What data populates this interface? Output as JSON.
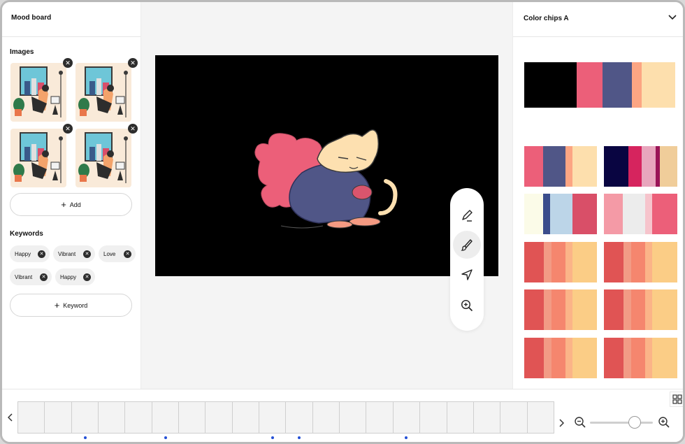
{
  "left_panel": {
    "title": "Mood board",
    "images_label": "Images",
    "add_label": "Add",
    "keywords_label": "Keywords",
    "keywords": [
      "Happy",
      "Vibrant",
      "Love",
      "Vibrant",
      "Happy"
    ],
    "add_keyword_label": "Keyword",
    "close_icon": "close-icon"
  },
  "right_panel": {
    "title": "Color chips A",
    "dropdown_icon": "chevron-down-icon"
  },
  "tools": [
    "pen-icon",
    "brush-icon",
    "navigate-icon",
    "zoom-in-icon"
  ],
  "colors": {
    "pink": "#ec5f79",
    "navy": "#505687",
    "peach": "#fca583",
    "cream": "#fddfad",
    "red": "#e05454",
    "salmon": "#f5866e",
    "yellow": "#fbcd86"
  }
}
